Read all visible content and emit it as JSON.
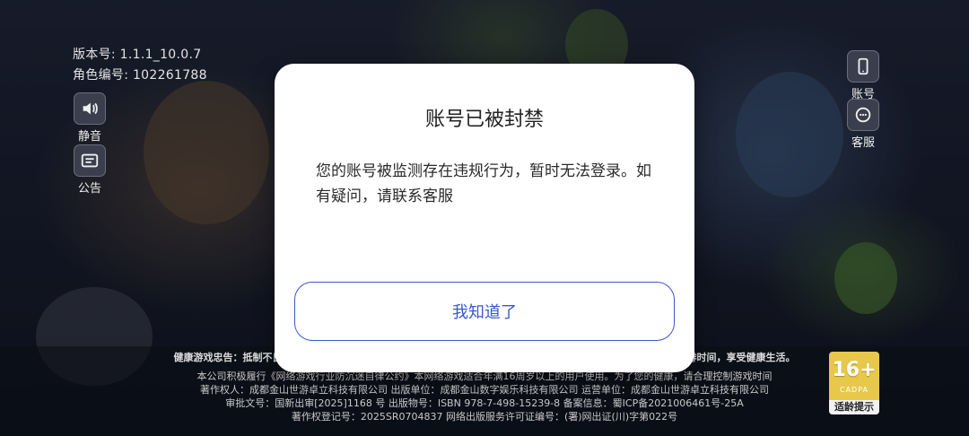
{
  "info": {
    "version": "版本号: 1.1.1_10.0.7",
    "role_id": "角色编号: 102261788"
  },
  "left_buttons": [
    {
      "label": "静音",
      "icon": "speaker-icon"
    },
    {
      "label": "公告",
      "icon": "announcement-icon"
    }
  ],
  "right_buttons": [
    {
      "label": "账号",
      "icon": "phone-icon"
    },
    {
      "label": "客服",
      "icon": "chat-icon"
    }
  ],
  "dialog": {
    "title": "账号已被封禁",
    "message": "您的账号被监测存在违规行为，暂时无法登录。如有疑问，请联系客服",
    "button_label": "我知道了"
  },
  "footer": {
    "line0": "健康游戏忠告：抵制不良游戏，拒绝盗版游戏。注意自我保护，谨防受骗上当。适度游戏益脑，沉迷游戏伤身。合理安排时间，享受健康生活。",
    "line1": "本公司积极履行《网络游戏行业防沉迷自律公约》本网络游戏适合年满16周岁以上的用户使用。为了您的健康，请合理控制游戏时间",
    "line2": "著作权人：成都金山世游卓立科技有限公司 出版单位：成都金山数字娱乐科技有限公司 运营单位：成都金山世游卓立科技有限公司",
    "line3": "审批文号：国新出审[2025]1168 号 出版物号：ISBN 978-7-498-15239-8 备案信息：蜀ICP备2021006461号-25A",
    "line4": "著作权登记号：2025SR0704837 网络出版服务许可证编号：(署)网出证(川)字第022号"
  },
  "age_badge": {
    "rating": "16+",
    "org": "CADPA",
    "tip": "适龄提示"
  },
  "colors": {
    "accent": "#3b57c9",
    "dialog_bg": "#ffffff",
    "age_badge": "#e8c84a"
  }
}
